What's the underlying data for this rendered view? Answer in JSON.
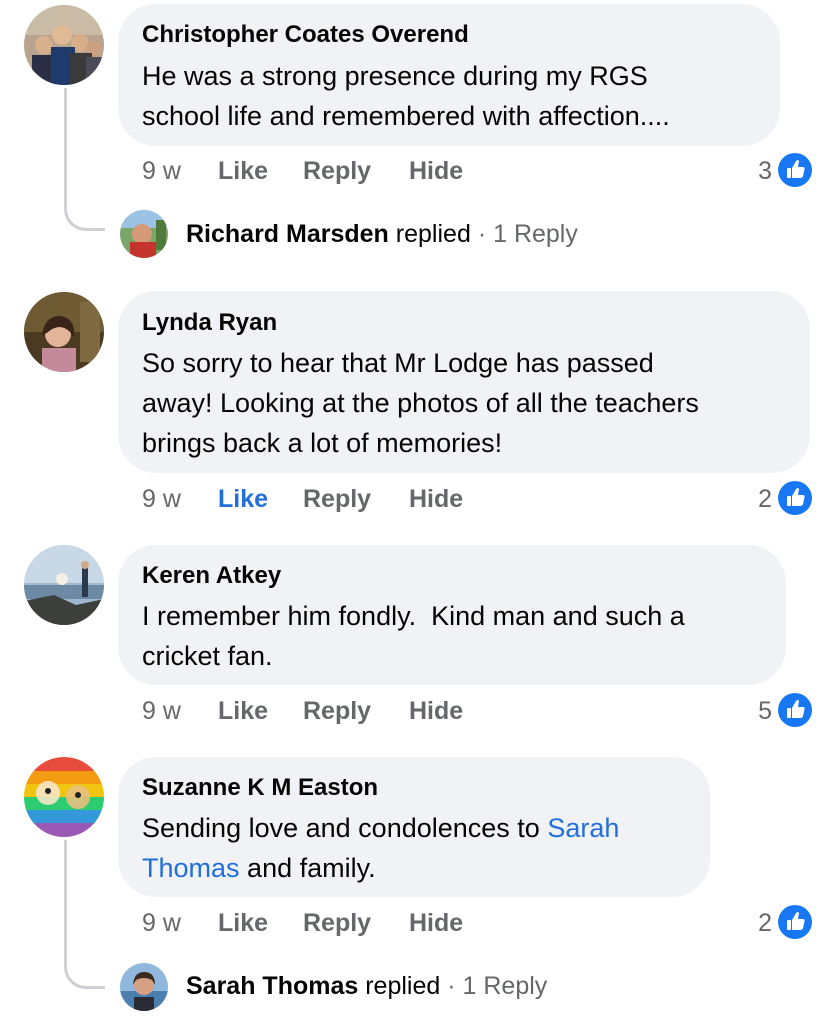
{
  "colors": {
    "bubble": "#f0f2f5",
    "link": "#216fdb",
    "meta": "#65676b",
    "like_badge": "#1877f2"
  },
  "icons": {
    "like_badge": "thumbs-up-icon"
  },
  "comments": [
    {
      "author": "Christopher Coates Overend",
      "lines": [
        "He was a strong presence during my RGS",
        "school life and remembered with affection...."
      ],
      "time": "9 w",
      "like": "Like",
      "reply": "Reply",
      "hide": "Hide",
      "like_count": "3",
      "liked": false,
      "reply_summary": {
        "name": "Richard Marsden",
        "verb": "replied",
        "separator": "·",
        "count": "1 Reply"
      }
    },
    {
      "author": "Lynda Ryan",
      "lines": [
        "So sorry to hear that Mr Lodge has passed",
        "away! Looking at the photos of all the teachers",
        "brings back a lot of memories!"
      ],
      "time": "9 w",
      "like": "Like",
      "reply": "Reply",
      "hide": "Hide",
      "like_count": "2",
      "liked": true
    },
    {
      "author": "Keren Atkey",
      "lines": [
        "I remember him fondly.  Kind man and such a",
        "cricket fan."
      ],
      "time": "9 w",
      "like": "Like",
      "reply": "Reply",
      "hide": "Hide",
      "like_count": "5",
      "liked": false
    },
    {
      "author": "Suzanne K M Easton",
      "line1_prefix": "Sending love and condolences to ",
      "mention_part1": "Sarah",
      "mention_part2": "Thomas",
      "line2_suffix": " and family.",
      "time": "9 w",
      "like": "Like",
      "reply": "Reply",
      "hide": "Hide",
      "like_count": "2",
      "liked": false,
      "reply_summary": {
        "name": "Sarah Thomas",
        "verb": "replied",
        "separator": "·",
        "count": "1 Reply"
      }
    }
  ]
}
